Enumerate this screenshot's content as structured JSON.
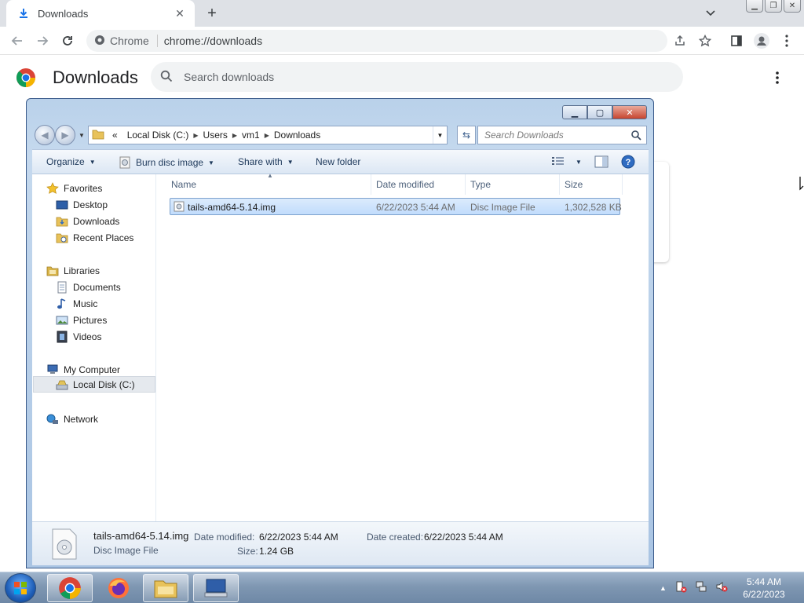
{
  "browser": {
    "tab_title": "Downloads",
    "omnibox_site": "Chrome",
    "omnibox_url": "chrome://downloads"
  },
  "downloads_page": {
    "title": "Downloads",
    "search_placeholder": "Search downloads"
  },
  "explorer": {
    "breadcrumb": {
      "overflow": "«",
      "segments": [
        "Local Disk (C:)",
        "Users",
        "vm1",
        "Downloads"
      ]
    },
    "search_placeholder": "Search Downloads",
    "commands": {
      "organize": "Organize",
      "burn": "Burn disc image",
      "share": "Share with",
      "new_folder": "New folder"
    },
    "nav": {
      "favorites": "Favorites",
      "desktop": "Desktop",
      "downloads": "Downloads",
      "recent_places": "Recent Places",
      "libraries": "Libraries",
      "documents": "Documents",
      "music": "Music",
      "pictures": "Pictures",
      "videos": "Videos",
      "my_computer": "My Computer",
      "local_disk": "Local Disk (C:)",
      "network": "Network"
    },
    "columns": {
      "name": "Name",
      "date_modified": "Date modified",
      "type": "Type",
      "size": "Size"
    },
    "files": [
      {
        "name": "tails-amd64-5.14.img",
        "date_modified": "6/22/2023 5:44 AM",
        "type": "Disc Image File",
        "size": "1,302,528 KB"
      }
    ],
    "details": {
      "filename": "tails-amd64-5.14.img",
      "filetype": "Disc Image File",
      "date_modified_label": "Date modified:",
      "date_modified": "6/22/2023 5:44 AM",
      "size_label": "Size:",
      "size": "1.24 GB",
      "date_created_label": "Date created:",
      "date_created": "6/22/2023 5:44 AM"
    }
  },
  "taskbar": {
    "time": "5:44 AM",
    "date": "6/22/2023"
  },
  "colors": {
    "chrome_blue": "#1a73e8",
    "selection": "#c1dcfc",
    "taskbar": "#7f97b2"
  }
}
